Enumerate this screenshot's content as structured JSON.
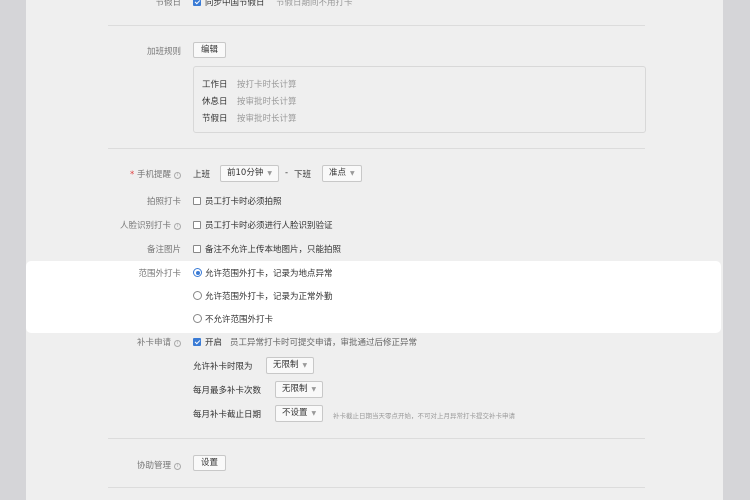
{
  "holiday": {
    "label": "节假日",
    "checkbox": "同步中国节假日",
    "note": "节假日期间不用打卡"
  },
  "overtime": {
    "label": "加班规则",
    "edit_button": "编辑",
    "rules": [
      {
        "day": "工作日",
        "desc": "按打卡时长计算"
      },
      {
        "day": "休息日",
        "desc": "按审批时长计算"
      },
      {
        "day": "节假日",
        "desc": "按审批时长计算"
      }
    ]
  },
  "reminder": {
    "label": "手机提醒",
    "required_mark": "*",
    "on_label": "上班",
    "on_value": "前10分钟",
    "dash": "-",
    "off_label": "下班",
    "off_value": "准点"
  },
  "photo": {
    "label": "拍照打卡",
    "checkbox": "员工打卡时必须拍照"
  },
  "face": {
    "label": "人脸识别打卡",
    "checkbox": "员工打卡时必须进行人脸识别验证"
  },
  "note_pic": {
    "label": "备注图片",
    "checkbox": "备注不允许上传本地图片，只能拍照"
  },
  "range": {
    "label": "范围外打卡",
    "options": [
      "允许范围外打卡，记录为地点异常",
      "允许范围外打卡，记录为正常外勤",
      "不允许范围外打卡"
    ],
    "selected": 0
  },
  "makeup": {
    "label": "补卡申请",
    "enable": "开启",
    "enable_desc": "员工异常打卡时可提交申请，审批通过后修正异常",
    "limit_label": "允许补卡时限为",
    "limit_value": "无限制",
    "monthly_label": "每月最多补卡次数",
    "monthly_value": "无限制",
    "deadline_label": "每月补卡截止日期",
    "deadline_value": "不设置",
    "deadline_hint": "补卡截止日期当天零点开始，不可对上月异常打卡提交补卡申请"
  },
  "assist": {
    "label": "协助管理",
    "button": "设置"
  }
}
